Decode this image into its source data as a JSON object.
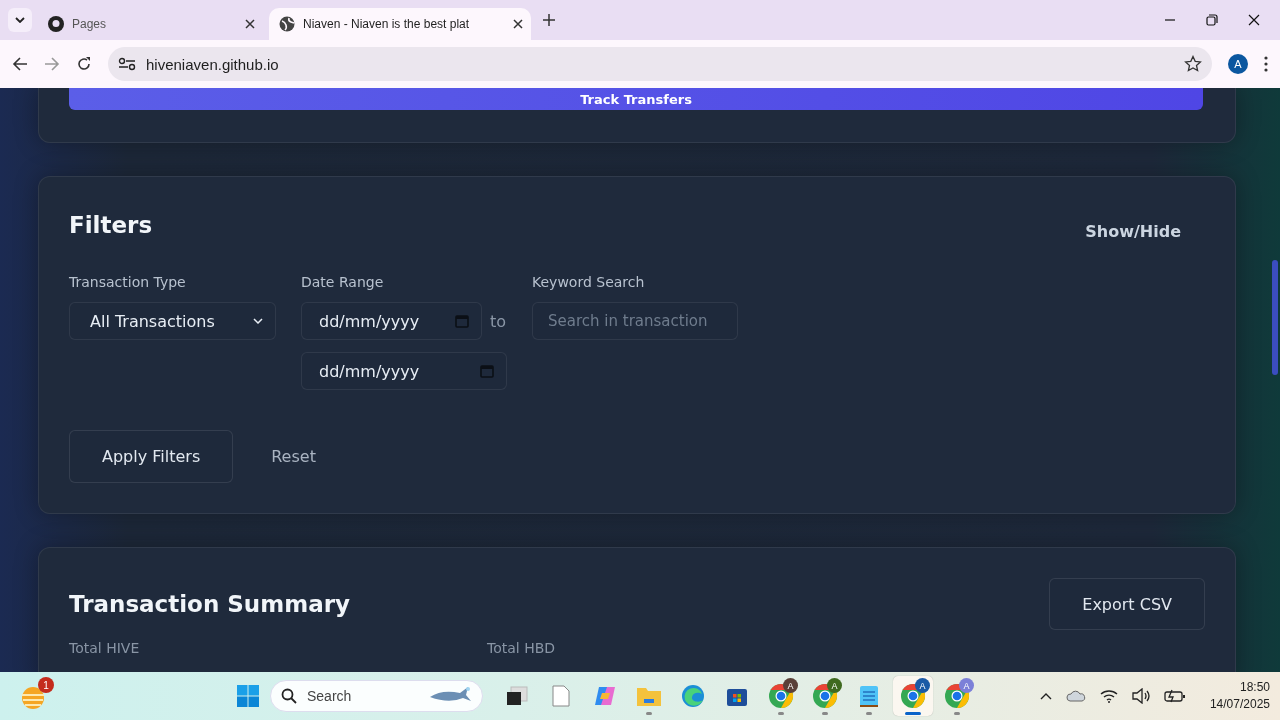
{
  "browser": {
    "tabs": [
      {
        "title": "Pages",
        "selected": false
      },
      {
        "title": "Niaven - Niaven is the best plat",
        "selected": true
      }
    ],
    "url": "hiveniaven.github.io",
    "profile_initial": "A"
  },
  "top_card": {
    "button": "Track Transfers"
  },
  "filters": {
    "title": "Filters",
    "toggle": "Show/Hide",
    "fields": [
      {
        "kind": "select",
        "label": "Transaction Type",
        "value": "All Transactions"
      },
      {
        "kind": "daterange",
        "label": "Date Range",
        "from": "dd/mm/yyyy",
        "separator": "to",
        "to": "dd/mm/yyyy"
      },
      {
        "kind": "search",
        "label": "Keyword Search",
        "placeholder": "Search in transaction"
      }
    ],
    "buttons": [
      {
        "label": "Apply Filters",
        "kind": "outlined"
      },
      {
        "label": "Reset",
        "kind": "text"
      }
    ]
  },
  "summary": {
    "title": "Transaction Summary",
    "export": "Export CSV",
    "stats": [
      {
        "label": "Total HIVE"
      },
      {
        "label": "Total HBD"
      }
    ]
  },
  "taskbar": {
    "weather_badge": "1",
    "search": "Search",
    "apps": [
      {
        "kind": "taskview",
        "running": false,
        "selected": false
      },
      {
        "kind": "file",
        "running": false,
        "selected": false
      },
      {
        "kind": "copilot",
        "running": false,
        "selected": false
      },
      {
        "kind": "folder",
        "running": true,
        "selected": false
      },
      {
        "kind": "edge",
        "running": false,
        "selected": false
      },
      {
        "kind": "store",
        "running": false,
        "selected": false
      },
      {
        "kind": "chrome",
        "initial": "A",
        "color": "#5a4038",
        "running": true,
        "selected": false
      },
      {
        "kind": "chrome",
        "initial": "A",
        "color": "#3f6a1f",
        "running": true,
        "selected": false
      },
      {
        "kind": "notepad",
        "running": true,
        "selected": false
      },
      {
        "kind": "chrome",
        "initial": "A",
        "color": "#1a5aa6",
        "running": true,
        "selected": true
      },
      {
        "kind": "chrome",
        "initial": "A",
        "color": "#7c80d8",
        "running": true,
        "selected": false
      }
    ],
    "time": "18:50",
    "date": "14/07/2025"
  }
}
